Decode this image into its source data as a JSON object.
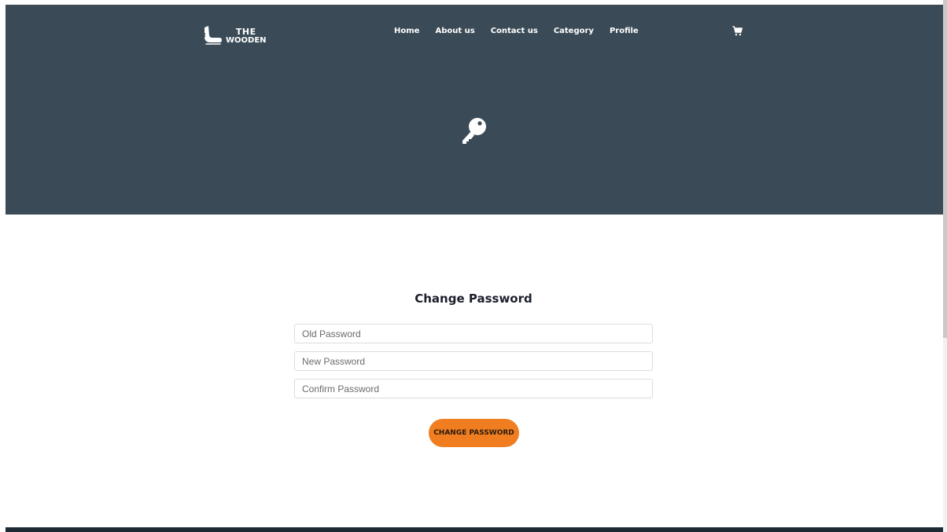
{
  "brand": {
    "line1": "THE",
    "line2": "WOODEN",
    "logo_icon": "armchair-icon"
  },
  "nav": {
    "items": [
      {
        "label": "Home"
      },
      {
        "label": "About us"
      },
      {
        "label": "Contact us"
      },
      {
        "label": "Category"
      },
      {
        "label": "Profile"
      }
    ],
    "cart_icon": "cart-icon"
  },
  "hero": {
    "icon": "key-icon",
    "background_color": "#3a4b57"
  },
  "form": {
    "title": "Change Password",
    "old_password": {
      "placeholder": "Old Password",
      "value": ""
    },
    "new_password": {
      "placeholder": "New Password",
      "value": ""
    },
    "confirm_password": {
      "placeholder": "Confirm Password",
      "value": ""
    },
    "submit_label": "CHANGE PASSWORD",
    "accent_color": "#f07d1f"
  }
}
